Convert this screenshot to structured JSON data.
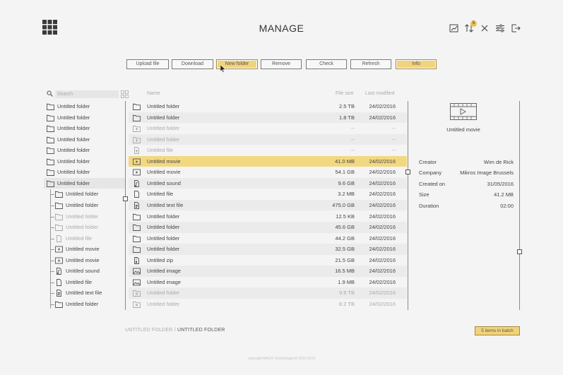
{
  "header": {
    "title": "MANAGE",
    "badge_count": "5",
    "icons": [
      "grid-menu-icon",
      "chart-icon",
      "transfer-icon",
      "close-icon",
      "sliders-icon",
      "logout-icon"
    ]
  },
  "toolbar": {
    "buttons": [
      {
        "label": "Upload file",
        "active": false
      },
      {
        "label": "Download",
        "active": false
      },
      {
        "label": "New folder",
        "active": true
      },
      {
        "label": "Remove",
        "active": false
      },
      {
        "label": "Check",
        "active": false
      },
      {
        "label": "Refresh",
        "active": false
      },
      {
        "label": "Info",
        "active": true
      }
    ]
  },
  "search": {
    "placeholder": "Search"
  },
  "tree": [
    {
      "label": "Untitled folder",
      "icon": "folder",
      "dim": false
    },
    {
      "label": "Untitled folder",
      "icon": "folder",
      "dim": false
    },
    {
      "label": "Untitled folder",
      "icon": "folder",
      "dim": false
    },
    {
      "label": "Untitled folder",
      "icon": "folder",
      "dim": false
    },
    {
      "label": "Untitled folder",
      "icon": "folder",
      "dim": false
    },
    {
      "label": "Untitled folder",
      "icon": "folder",
      "dim": false
    },
    {
      "label": "Untitled folder",
      "icon": "folder",
      "dim": false
    },
    {
      "label": "Untitled folder",
      "icon": "folder",
      "dim": false,
      "selected": true
    },
    {
      "label": "Untitled folder",
      "icon": "folder",
      "dim": false,
      "child": true
    },
    {
      "label": "Untitled folder",
      "icon": "folder",
      "dim": false,
      "child": true
    },
    {
      "label": "Untitled folder",
      "icon": "folder",
      "dim": true,
      "child": true
    },
    {
      "label": "Untitled folder",
      "icon": "folder",
      "dim": true,
      "child": true
    },
    {
      "label": "Untitled file",
      "icon": "file",
      "dim": true,
      "child": true
    },
    {
      "label": "Untitled movie",
      "icon": "movie",
      "dim": false,
      "child": true
    },
    {
      "label": "Untitled movie",
      "icon": "movie",
      "dim": false,
      "child": true
    },
    {
      "label": "Untitled sound",
      "icon": "sound",
      "dim": false,
      "child": true
    },
    {
      "label": "Untitled file",
      "icon": "file",
      "dim": false,
      "child": true
    },
    {
      "label": "Untitled text file",
      "icon": "text",
      "dim": false,
      "child": true
    },
    {
      "label": "Untitled folder",
      "icon": "folder",
      "dim": false,
      "child": true
    }
  ],
  "list": {
    "columns": {
      "name": "Name",
      "size": "File size",
      "modified": "Last modified"
    },
    "rows": [
      {
        "name": "Untitled folder",
        "size": "2.5 TB",
        "date": "24/02/2016",
        "icon": "folder"
      },
      {
        "name": "Untitled folder",
        "size": "1.8 TB",
        "date": "24/02/2016",
        "icon": "folder"
      },
      {
        "name": "Untitled folder",
        "size": "--",
        "date": "--",
        "icon": "folder-up",
        "dim": true
      },
      {
        "name": "Untitled folder",
        "size": "--",
        "date": "--",
        "icon": "folder-up",
        "dim": true
      },
      {
        "name": "Untitled file",
        "size": "--",
        "date": "--",
        "icon": "file-up",
        "dim": true
      },
      {
        "name": "Untitled movie",
        "size": "41.0 MB",
        "date": "24/02/2016",
        "icon": "movie",
        "selected": true
      },
      {
        "name": "Untitled movie",
        "size": "54.1 GB",
        "date": "24/02/2016",
        "icon": "movie"
      },
      {
        "name": "Untitled sound",
        "size": "9.6 GB",
        "date": "24/02/2016",
        "icon": "sound"
      },
      {
        "name": "Untitled file",
        "size": "3.2 MB",
        "date": "24/02/2016",
        "icon": "file"
      },
      {
        "name": "Untitled text file",
        "size": "475.0 GB",
        "date": "24/02/2016",
        "icon": "text"
      },
      {
        "name": "Untitled folder",
        "size": "12.5 KB",
        "date": "24/02/2016",
        "icon": "folder"
      },
      {
        "name": "Untitled folder",
        "size": "45.6 GB",
        "date": "24/02/2016",
        "icon": "folder"
      },
      {
        "name": "Untitled folder",
        "size": "44.2 GB",
        "date": "24/02/2016",
        "icon": "folder"
      },
      {
        "name": "Untitled folder",
        "size": "32.5 GB",
        "date": "24/02/2016",
        "icon": "folder"
      },
      {
        "name": "Untitled zip",
        "size": "21.5 GB",
        "date": "24/02/2016",
        "icon": "zip"
      },
      {
        "name": "Untitled image",
        "size": "16.5 MB",
        "date": "24/02/2016",
        "icon": "image"
      },
      {
        "name": "Untitled image",
        "size": "1.9 MB",
        "date": "24/02/2016",
        "icon": "image"
      },
      {
        "name": "Untitled folder",
        "size": "9.9 TB",
        "date": "24/02/2016",
        "icon": "folder-x",
        "dim": true
      },
      {
        "name": "Untitled folder",
        "size": "8.2 TB",
        "date": "24/02/2016",
        "icon": "folder-x",
        "dim": true
      }
    ]
  },
  "details": {
    "preview_icon": "movie-icon",
    "title": "Untitled movie",
    "fields": [
      {
        "label": "Creator",
        "value": "Wim de Rick"
      },
      {
        "label": "Company",
        "value": "Mikros Image Brussels"
      },
      {
        "label": "Created on",
        "value": "31/05/2016"
      },
      {
        "label": "Size",
        "value": "41.2 MB"
      },
      {
        "label": "Duration",
        "value": "02:00"
      }
    ]
  },
  "footer": {
    "breadcrumb_parent": "UNTITLED FOLDER",
    "breadcrumb_sep": " / ",
    "breadcrumb_current": "UNTITLED FOLDER",
    "batch_label": "5 items in batch",
    "copyright": "copyright MAUD Technologies® 2015-2016"
  }
}
